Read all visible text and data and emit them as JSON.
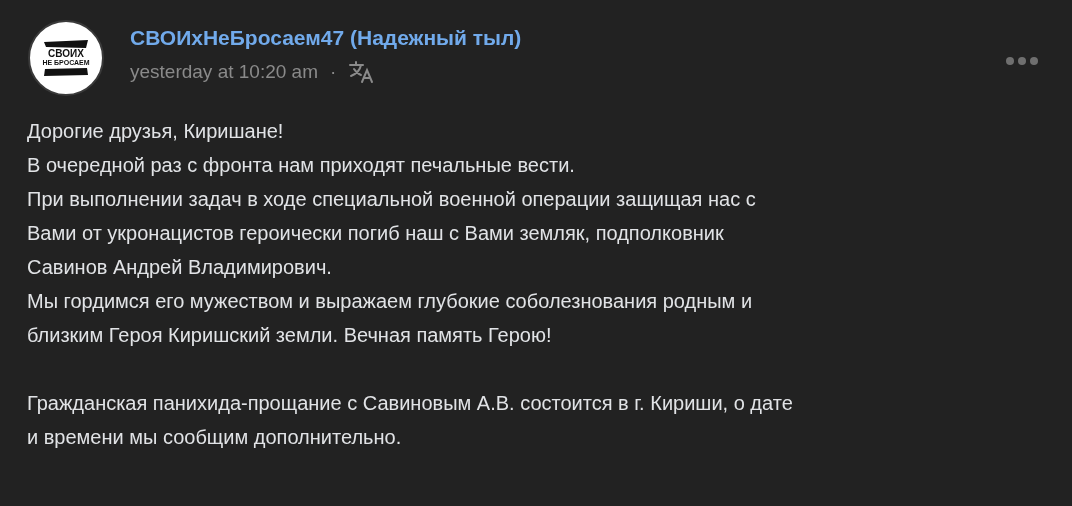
{
  "post": {
    "author": "СВОИхНеБросаем47 (Надежный тыл)",
    "time": "yesterday at 10:20 am",
    "separator": "·",
    "avatar": {
      "line_1": "СВОИХ",
      "line_2": "НЕ БРОСАЕМ"
    },
    "sections": [
      {
        "paragraphs": [
          {
            "lines": [
              "Дорогие друзья, Киришане!"
            ]
          },
          {
            "lines": [
              "В очередной раз с фронта нам приходят печальные вести."
            ]
          },
          {
            "lines": [
              "При выполнении задач в ходе специальной военной операции защищая нас с",
              "Вами от укронацистов героически погиб наш с Вами земляк, подполковник",
              "Савинов Андрей Владимирович."
            ]
          },
          {
            "lines": [
              "Мы гордимся его мужеством и выражаем глубокие соболезнования родным и",
              "близким Героя Киришский земли. Вечная память Герою!"
            ]
          }
        ]
      },
      {
        "paragraphs": [
          {
            "lines": [
              "Гражданская панихида-прощание с Савиновым А.В. состоится в г. Кириши, о дате",
              "и времени мы сообщим дополнительно."
            ]
          }
        ]
      }
    ]
  }
}
